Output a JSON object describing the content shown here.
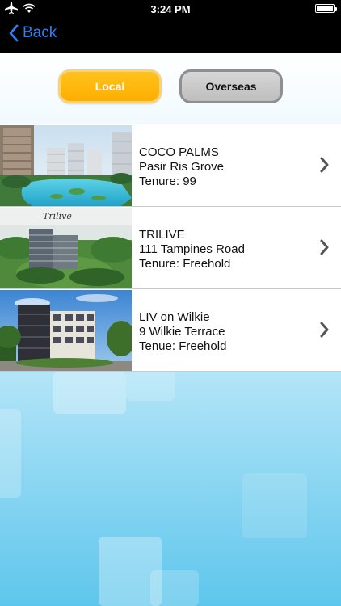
{
  "status_bar": {
    "time": "3:24 PM"
  },
  "nav": {
    "back_label": "Back"
  },
  "segments": {
    "local_label": "Local",
    "overseas_label": "Overseas"
  },
  "listings": [
    {
      "name": "COCO PALMS",
      "address": "Pasir Ris Grove",
      "tenure": "Tenure: 99"
    },
    {
      "name": "TRILIVE",
      "address": "111 Tampines Road",
      "tenure": "Tenure: Freehold",
      "logo_text": "Trilive"
    },
    {
      "name": "LIV on Wilkie",
      "address": "9 Wilkie Terrace",
      "tenure": "Tenue: Freehold"
    }
  ],
  "colors": {
    "accent": "#2a7ff5",
    "local_active": "#ffb300",
    "overseas_inactive": "#c8c8c8"
  }
}
